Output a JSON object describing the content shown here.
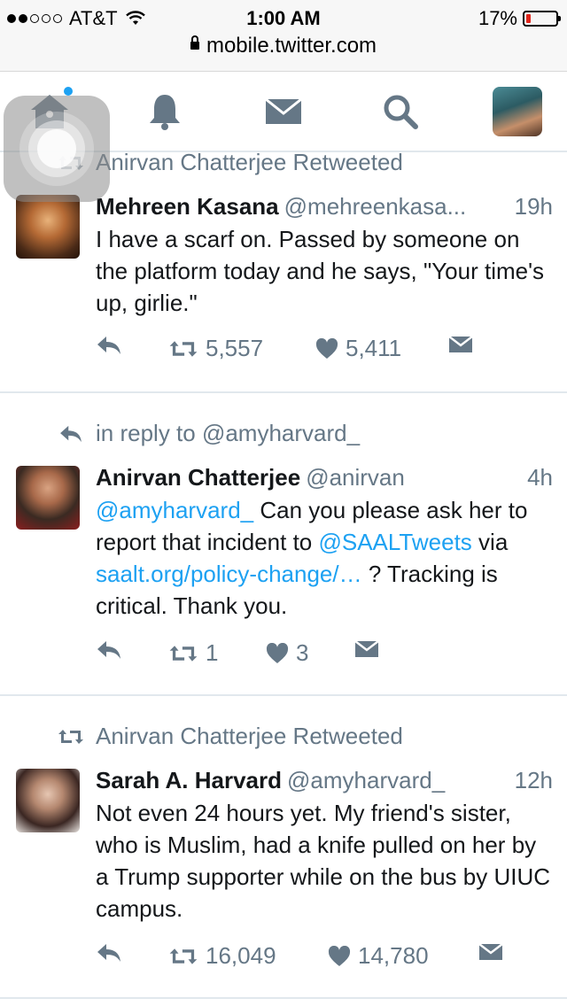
{
  "status_bar": {
    "carrier": "AT&T",
    "time": "1:00 AM",
    "battery": "17%",
    "battery_level": 0.17,
    "battery_color": "#e0251b"
  },
  "browser": {
    "url": "mobile.twitter.com"
  },
  "nav": {
    "icons": [
      "home-icon",
      "notifications-bell-icon",
      "messages-envelope-icon",
      "search-icon",
      "profile-avatar"
    ],
    "accent": "#1da1f2"
  },
  "tweets": [
    {
      "context": "Anirvan Chatterjee Retweeted",
      "name": "Mehreen Kasana",
      "handle": "@mehreenkasa...",
      "time": "19h",
      "text": "I have a scarf on. Passed by someone on the platform today and he says, \"Your time's up, girlie.\"",
      "retweets": "5,557",
      "likes": "5,411"
    },
    {
      "context": "in reply to @amyharvard_",
      "name": "Anirvan Chatterjee",
      "handle": "@anirvan",
      "time": "4h",
      "text_parts": {
        "mention1": "@amyharvard_",
        "t1": " Can you please ask her to report that incident to ",
        "mention2": "@SAALTweets",
        "t2": " via ",
        "link": "saalt.org/policy-change/…",
        "t3": " ? Tracking is critical. Thank you."
      },
      "retweets": "1",
      "likes": "3"
    },
    {
      "context": "Anirvan Chatterjee Retweeted",
      "name": "Sarah A. Harvard",
      "handle": "@amyharvard_",
      "time": "12h",
      "text": "Not even 24 hours yet. My friend's sister, who is Muslim, had a knife pulled on her by a Trump supporter while on the bus by UIUC campus.",
      "retweets": "16,049",
      "likes": "14,780"
    }
  ]
}
